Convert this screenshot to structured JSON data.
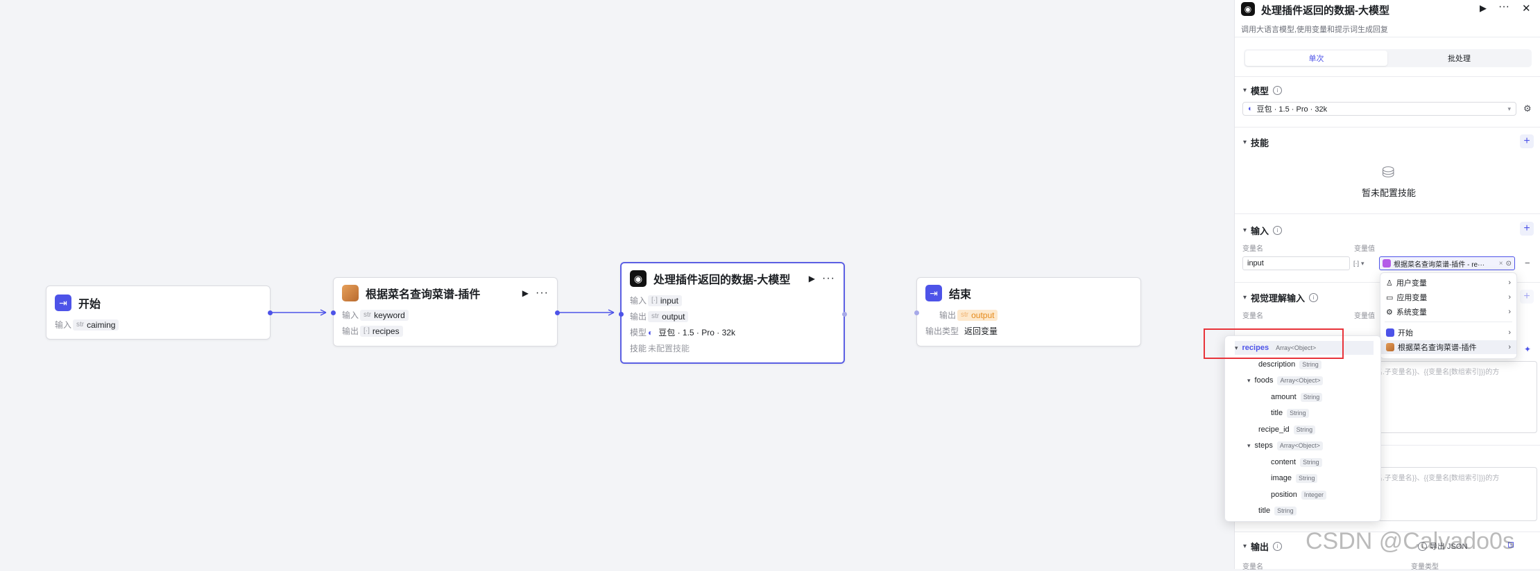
{
  "workflow": {
    "start_node": {
      "title": "开始",
      "input_label": "输入",
      "input_type": "str",
      "input_var": "caiming"
    },
    "plugin_node": {
      "title": "根据菜名查询菜谱-插件",
      "input_label": "输入",
      "input_type": "str",
      "input_var": "keyword",
      "output_label": "输出",
      "output_type": "[·]",
      "output_var": "recipes"
    },
    "llm_node": {
      "title": "处理插件返回的数据-大模型",
      "input_label": "输入",
      "input_type": "[·]",
      "input_var": "input",
      "output_label": "输出",
      "output_type": "str",
      "output_var": "output",
      "model_label": "模型",
      "model_value": "豆包 · 1.5 · Pro · 32k",
      "skill_label": "技能",
      "skill_value": "未配置技能"
    },
    "end_node": {
      "title": "结束",
      "output_label": "输出",
      "output_type": "str",
      "output_var": "output",
      "output_kind_label": "输出类型",
      "output_kind_value": "返回变量"
    }
  },
  "panel": {
    "title": "处理插件返回的数据-大模型",
    "subtitle": "调用大语言模型,使用变量和提示词生成回复",
    "tabs": [
      "单次",
      "批处理"
    ],
    "model_section": {
      "title": "模型",
      "value": "豆包 · 1.5 · Pro · 32k"
    },
    "skill_section": {
      "title": "技能",
      "empty": "暂未配置技能"
    },
    "input_section": {
      "title": "输入",
      "col_name": "变量名",
      "col_value": "变量值",
      "var_name": "input",
      "type_short": "[·]",
      "ref_value": "根据菜名查询菜谱-插件 - re···"
    },
    "vision_section": {
      "title": "视觉理解输入",
      "col_name": "变量名",
      "col_value": "变量值"
    },
    "prompt_hint": "变量名.子变量名}}、{{变量名[数组索引]}}的方",
    "prompt_hint2": "变量名.子变量名}}、{{变量名[数组索引]}}的方",
    "output_section": {
      "title": "输出",
      "col_name": "变量名",
      "col_type": "变量类型",
      "format_btn": "导出 JSON"
    }
  },
  "menu": {
    "items": [
      "用户变量",
      "应用变量",
      "系统变量",
      "开始",
      "根据菜名查询菜谱-插件"
    ]
  },
  "tree": [
    {
      "name": "recipes",
      "type": "Array<Object>"
    },
    {
      "name": "description",
      "type": "String"
    },
    {
      "name": "foods",
      "type": "Array<Object>"
    },
    {
      "name": "amount",
      "type": "String"
    },
    {
      "name": "title",
      "type": "String"
    },
    {
      "name": "recipe_id",
      "type": "String"
    },
    {
      "name": "steps",
      "type": "Array<Object>"
    },
    {
      "name": "content",
      "type": "String"
    },
    {
      "name": "image",
      "type": "String"
    },
    {
      "name": "position",
      "type": "Integer"
    },
    {
      "name": "title",
      "type": "String"
    }
  ],
  "watermark": "CSDN @Calvado0s",
  "colors": {
    "accent": "#4d53e8",
    "highlight_box": "#e8333a",
    "orange": "#e58a1b"
  }
}
